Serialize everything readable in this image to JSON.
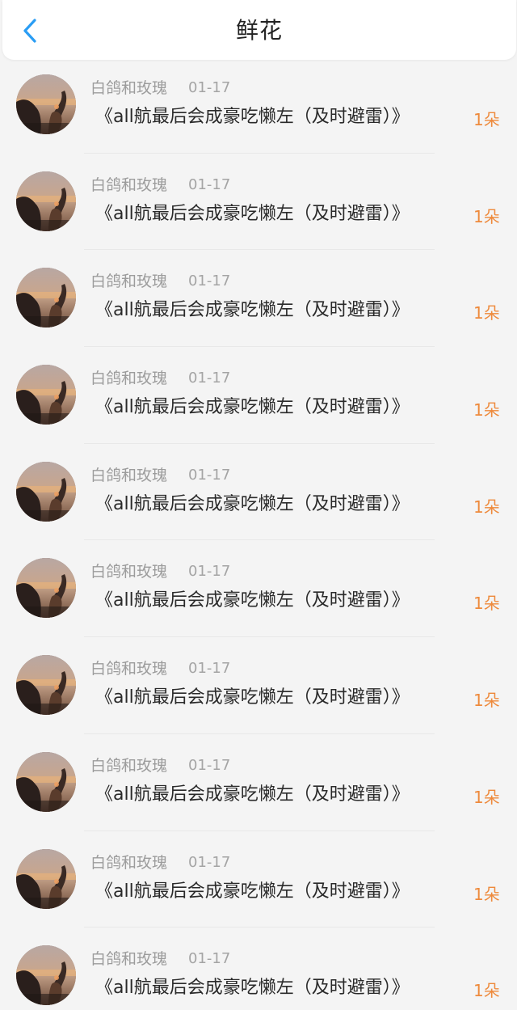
{
  "header": {
    "title": "鲜花",
    "back_icon": "chevron-left-icon",
    "accent_color": "#2a9df4"
  },
  "list": {
    "count_color": "#ee8a3c",
    "items": [
      {
        "user": "白鸽和玫瑰",
        "date": "01-17",
        "title": "《all航最后会成豪吃懒左（及时避雷）》",
        "count": "1朵"
      },
      {
        "user": "白鸽和玫瑰",
        "date": "01-17",
        "title": "《all航最后会成豪吃懒左（及时避雷）》",
        "count": "1朵"
      },
      {
        "user": "白鸽和玫瑰",
        "date": "01-17",
        "title": "《all航最后会成豪吃懒左（及时避雷）》",
        "count": "1朵"
      },
      {
        "user": "白鸽和玫瑰",
        "date": "01-17",
        "title": "《all航最后会成豪吃懒左（及时避雷）》",
        "count": "1朵"
      },
      {
        "user": "白鸽和玫瑰",
        "date": "01-17",
        "title": "《all航最后会成豪吃懒左（及时避雷）》",
        "count": "1朵"
      },
      {
        "user": "白鸽和玫瑰",
        "date": "01-17",
        "title": "《all航最后会成豪吃懒左（及时避雷）》",
        "count": "1朵"
      },
      {
        "user": "白鸽和玫瑰",
        "date": "01-17",
        "title": "《all航最后会成豪吃懒左（及时避雷）》",
        "count": "1朵"
      },
      {
        "user": "白鸽和玫瑰",
        "date": "01-17",
        "title": "《all航最后会成豪吃懒左（及时避雷）》",
        "count": "1朵"
      },
      {
        "user": "白鸽和玫瑰",
        "date": "01-17",
        "title": "《all航最后会成豪吃懒左（及时避雷）》",
        "count": "1朵"
      },
      {
        "user": "白鸽和玫瑰",
        "date": "01-17",
        "title": "《all航最后会成豪吃懒左（及时避雷）》",
        "count": "1朵"
      }
    ]
  }
}
